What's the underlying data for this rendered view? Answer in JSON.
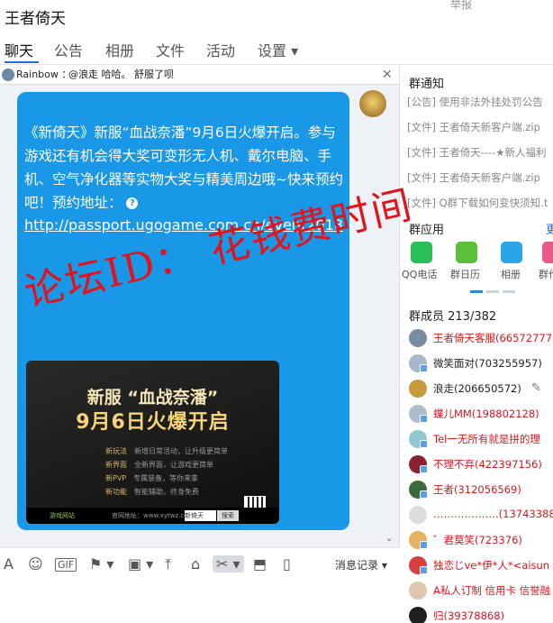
{
  "window": {
    "title": "王者倚天",
    "report": "举报"
  },
  "tabs": [
    {
      "label": "聊天"
    },
    {
      "label": "公告"
    },
    {
      "label": "相册"
    },
    {
      "label": "文件"
    },
    {
      "label": "活动"
    },
    {
      "label": "设置 ▾"
    }
  ],
  "quote": {
    "name": "Rainbow ：",
    "text": "@浪走 哈哈。 舒服了呗",
    "close": "✕"
  },
  "message": {
    "text": "《新倚天》新服“血战奈潘”9月6日火爆开启。参与游戏还有机会得大奖可变形无人机、戴尔电脑、手机、空气净化器等实物大奖与精美周边哦~快来预约吧！预约地址：",
    "qmark": "?",
    "link": "http://passport.ugogame.com.cn/event2018"
  },
  "poster": {
    "title": "新服 “血战奈潘”",
    "date": "9月6日火爆开启",
    "lines": [
      {
        "label": "新玩法",
        "desc": "新增日常活动，让升级更简单"
      },
      {
        "label": "新界面",
        "desc": "全新界面，让游戏更简单"
      },
      {
        "label": "新PVP",
        "desc": "专属装备，等你来拿"
      },
      {
        "label": "新功能",
        "desc": "智能辅助，终身免费"
      }
    ],
    "logo": "游戏网站",
    "url": "官网地址：www.xytwz.com.cn",
    "search": "新倚天",
    "search_btn": "搜索"
  },
  "scroll_down": "⌄",
  "toolbar": {
    "font": "A",
    "emoji": "☺",
    "gif": "GIF",
    "gift": "⚑ ▾",
    "image": "▣ ▾",
    "upload": "⤒",
    "vote": "⌂",
    "screenshot": "✂ ▾",
    "red_packet": "⬒",
    "shake": "▯",
    "history": "消息记录 ▾"
  },
  "group_notice": {
    "title": "群通知",
    "items": [
      "[公告] 使用非法外挂处罚公告",
      "[文件] 王者倚天新客户端.zip",
      "[文件] 王者倚天----★新人福利",
      "[文件] 王者倚天新客户端.zip",
      "[文件] Q群下载如何变快须知.t"
    ]
  },
  "group_apps": {
    "title": "群应用",
    "more": "更",
    "apps": [
      {
        "label": "QQ电话",
        "color": "#2bbf5a"
      },
      {
        "label": "群日历",
        "color": "#5bbf3a"
      },
      {
        "label": "相册",
        "color": "#2aa6e8"
      },
      {
        "label": "群作",
        "color": "#e85a8a"
      }
    ]
  },
  "members": {
    "title": "群成员 213/382",
    "edit": "✎",
    "list": [
      {
        "name": "王者倚天客服(66572777",
        "color": "#e0141d",
        "avatar": "#7a8aa0",
        "badge": false
      },
      {
        "name": "微笑面对(703255957)",
        "color": "#222222",
        "avatar": "#a8b8c8",
        "badge": true
      },
      {
        "name": "浪走(206650572)",
        "color": "#222222",
        "avatar": "#c79a3c",
        "badge": false
      },
      {
        "name": "蝶儿MM(198802128)",
        "color": "#e0141d",
        "avatar": "#b0bccb",
        "badge": true
      },
      {
        "name": "Tel一无所有就是拼的理",
        "color": "#e0141d",
        "avatar": "#8ec8d0",
        "badge": true
      },
      {
        "name": "不理不弃(422397156)",
        "color": "#e0141d",
        "avatar": "#8a2030",
        "badge": true
      },
      {
        "name": "王者(312056569)",
        "color": "#e0141d",
        "avatar": "#3a6a3a",
        "badge": true
      },
      {
        "name": "……………….(13743388657",
        "color": "#e0141d",
        "avatar": "#dddddd",
        "badge": false
      },
      {
        "name": "゛君莫笑(723376)",
        "color": "#e0141d",
        "avatar": "#e8b060",
        "badge": true
      },
      {
        "name": "独恋じve*伊*人*<aisun",
        "color": "#e0141d",
        "avatar": "#d84040",
        "badge": true
      },
      {
        "name": "A私人订制 信用卡 信誉融",
        "color": "#e0141d",
        "avatar": "#e0c8b0",
        "badge": false
      },
      {
        "name": "归(39378868)",
        "color": "#e0141d",
        "avatar": "#202020",
        "badge": false
      }
    ]
  },
  "watermark": "论坛ID： 花钱费时间"
}
